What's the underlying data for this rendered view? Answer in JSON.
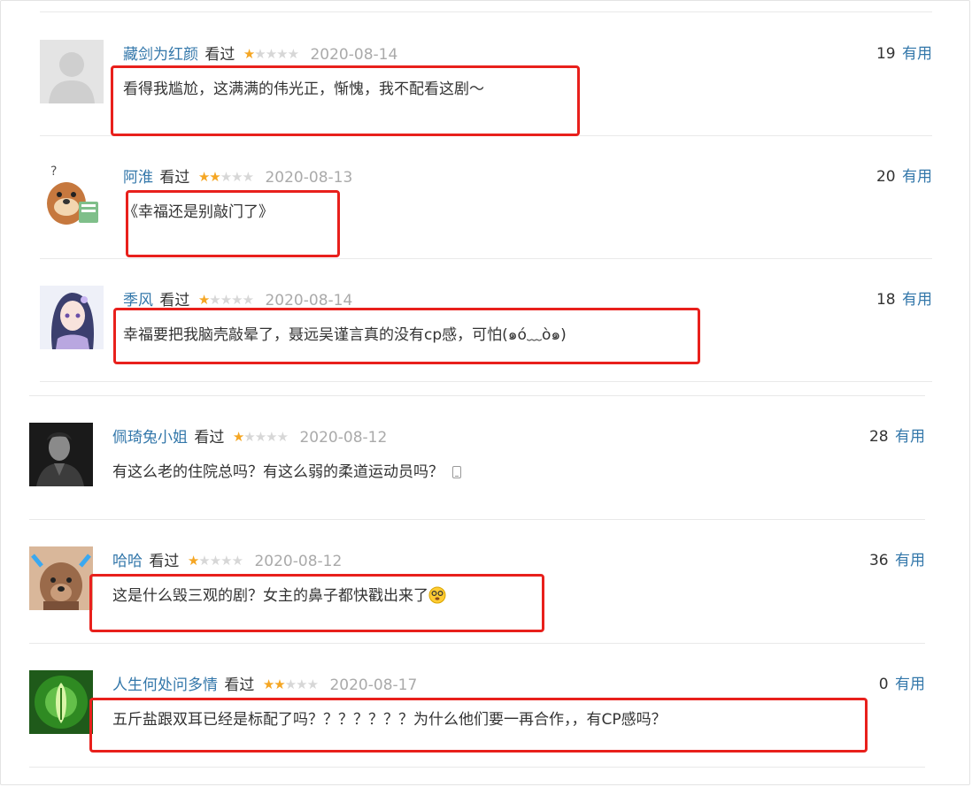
{
  "comments": [
    {
      "user": "藏剑为红颜",
      "status": "看过",
      "stars_on": 1,
      "stars_total": 5,
      "date": "2020-08-14",
      "votes": "19",
      "useful": "有用",
      "text": "看得我尴尬，这满满的伟光正，惭愧，我不配看这剧～",
      "avatar": "default-avatar-icon"
    },
    {
      "user": "阿淮",
      "status": "看过",
      "stars_on": 2,
      "stars_total": 5,
      "date": "2020-08-13",
      "votes": "20",
      "useful": "有用",
      "text": "《幸福还是别敲门了》",
      "avatar": "otter-avatar-icon"
    },
    {
      "user": "季风",
      "status": "看过",
      "stars_on": 1,
      "stars_total": 5,
      "date": "2020-08-14",
      "votes": "18",
      "useful": "有用",
      "text": "幸福要把我脑壳敲晕了，聂远吴谨言真的没有cp感，可怕(๑ó﹏ò๑)",
      "avatar": "anime-avatar-icon"
    },
    {
      "user": "佩琦兔小姐",
      "status": "看过",
      "stars_on": 1,
      "stars_total": 5,
      "date": "2020-08-12",
      "votes": "28",
      "useful": "有用",
      "text": "有这么老的住院总吗？有这么弱的柔道运动员吗？",
      "avatar": "portrait-avatar-icon",
      "mobile_icon": "mobile-phone-icon"
    },
    {
      "user": "哈哈",
      "status": "看过",
      "stars_on": 1,
      "stars_total": 5,
      "date": "2020-08-12",
      "votes": "36",
      "useful": "有用",
      "text": "这是什么毁三观的剧？女主的鼻子都快戳出来了",
      "avatar": "dog-avatar-icon",
      "emoji": "dizzy-face-emoji"
    },
    {
      "user": "人生何处问多情",
      "status": "看过",
      "stars_on": 2,
      "stars_total": 5,
      "date": "2020-08-17",
      "votes": "0",
      "useful": "有用",
      "text": "五斤盐跟双耳已经是标配了吗？？？？？？？为什么他们要一再合作，，有CP感吗？",
      "avatar": "green-plant-avatar-icon"
    }
  ],
  "colors": {
    "link": "#3377aa",
    "star": "#f5a623",
    "highlight": "#e8201c",
    "date": "#aaaaaa"
  }
}
